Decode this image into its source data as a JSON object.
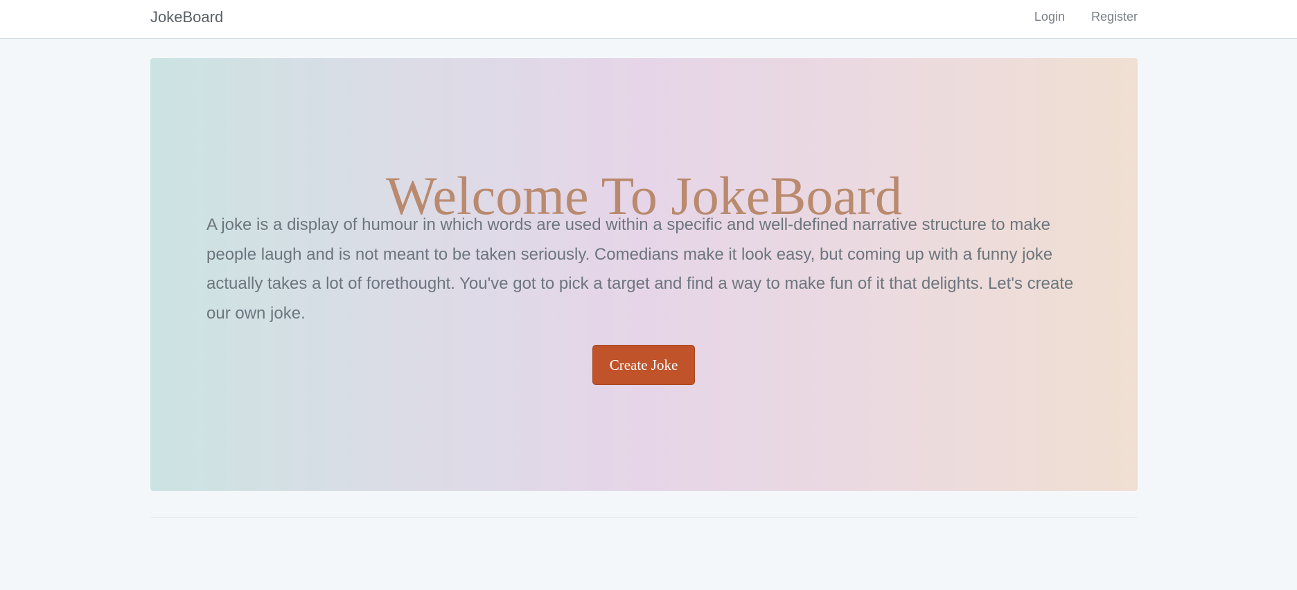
{
  "nav": {
    "brand": "JokeBoard",
    "links": [
      "Login",
      "Register"
    ]
  },
  "hero": {
    "title": "Welcome To JokeBoard",
    "text": "A joke is a display of humour in which words are used within a specific and well-defined narrative structure to make people laugh and is not meant to be taken seriously. Comedians make it look easy, but coming up with a funny joke actually takes a lot of forethought. You've got to pick a target and find a way to make fun of it that delights. Let's create our own joke.",
    "button": "Create Joke"
  },
  "colors": {
    "accent": "#c0532a",
    "title": "#b98a6e",
    "background": "#f3f7f9"
  }
}
